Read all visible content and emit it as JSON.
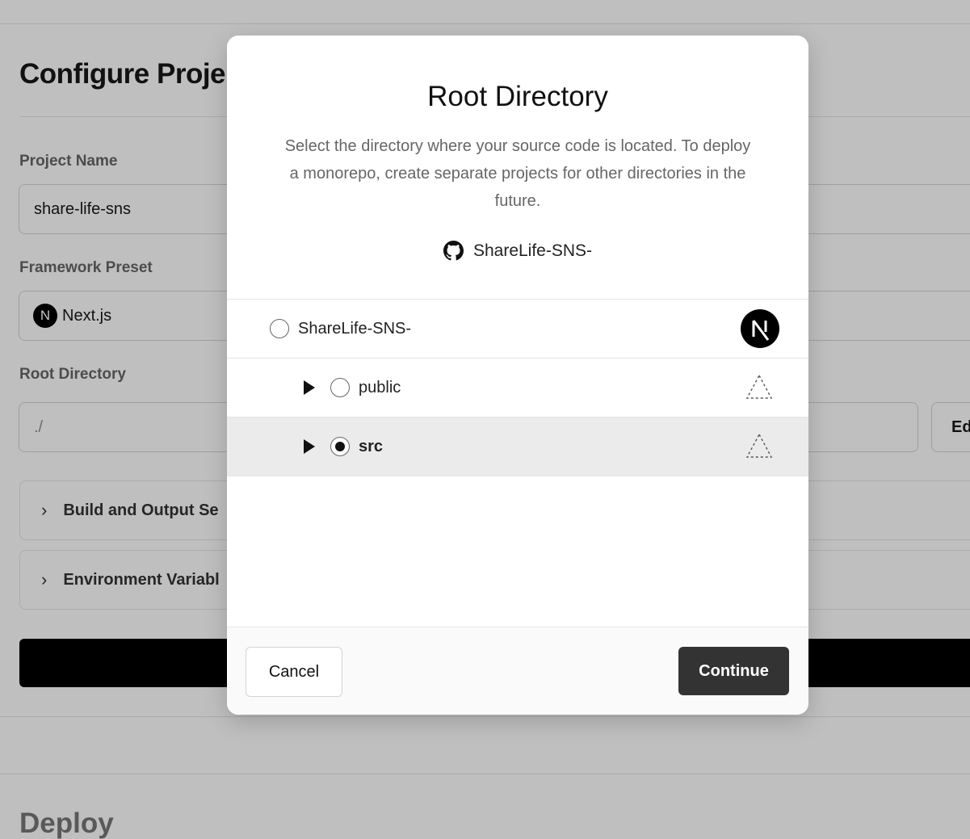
{
  "background": {
    "page_title": "Configure Proje",
    "project_name": {
      "label": "Project Name",
      "value": "share-life-sns"
    },
    "framework_preset": {
      "label": "Framework Preset",
      "logo_letter": "N",
      "value": "Next.js"
    },
    "root_directory": {
      "label": "Root Directory",
      "value": "./",
      "edit_label": "Ed"
    },
    "sections": [
      {
        "label": "Build and Output Se",
        "icon": "chevron-right-icon"
      },
      {
        "label": "Environment Variabl",
        "icon": "chevron-right-icon"
      }
    ],
    "deploy_heading": "Deploy"
  },
  "modal": {
    "title": "Root Directory",
    "description": "Select the directory where your source code is located. To deploy a monorepo, create separate projects for other directories in the future.",
    "repo": {
      "icon": "github-icon",
      "name": "ShareLife-SNS-"
    },
    "tree": [
      {
        "label": "ShareLife-SNS-",
        "depth": 0,
        "expandable": false,
        "selected": false,
        "framework_icon": "nextjs-icon"
      },
      {
        "label": "public",
        "depth": 1,
        "expandable": true,
        "selected": false,
        "framework_icon": "dashed-triangle-icon"
      },
      {
        "label": "src",
        "depth": 1,
        "expandable": true,
        "selected": true,
        "framework_icon": "dashed-triangle-icon"
      }
    ],
    "footer": {
      "cancel_label": "Cancel",
      "continue_label": "Continue"
    }
  },
  "colors": {
    "overlay": "#000000",
    "primary_button": "#333333",
    "selected_row": "#ebebeb"
  }
}
